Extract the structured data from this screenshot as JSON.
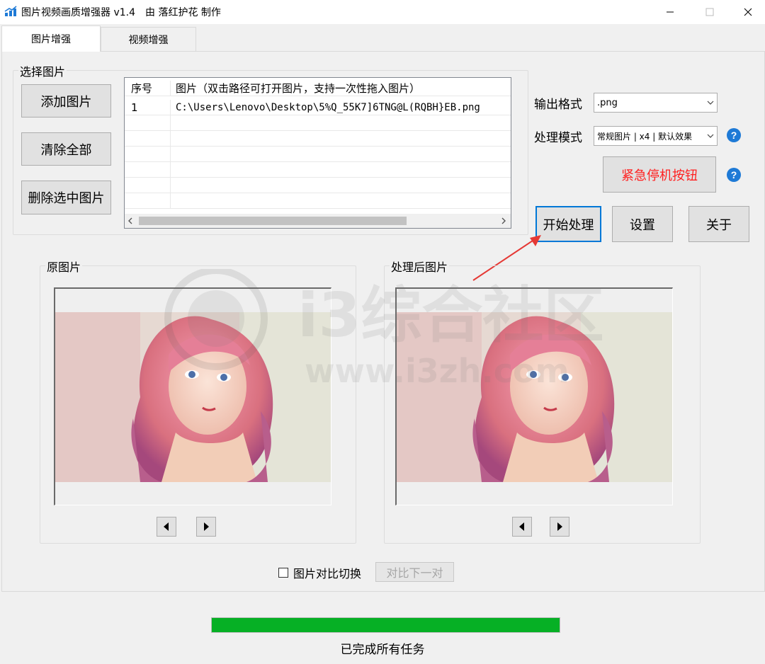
{
  "window": {
    "title": "图片视频画质增强器 v1.4　由 落红护花 制作"
  },
  "tabs": [
    {
      "label": "图片增强",
      "active": true
    },
    {
      "label": "视频增强",
      "active": false
    }
  ],
  "select_group": {
    "title": "选择图片",
    "buttons": {
      "add": "添加图片",
      "clear": "清除全部",
      "delete": "删除选中图片"
    },
    "list": {
      "headers": [
        "序号",
        "图片（双击路径可打开图片，支持一次性拖入图片）"
      ],
      "rows": [
        {
          "index": "1",
          "path": "C:\\Users\\Lenovo\\Desktop\\5%Q_55K7]6TNG@L(RQBH}EB.png"
        }
      ]
    }
  },
  "settings": {
    "output_format_label": "输出格式",
    "output_format_value": ".png",
    "mode_label": "处理模式",
    "mode_value": "常规图片 | x4 | 默认效果",
    "emergency_stop": "紧急停机按钮",
    "start": "开始处理",
    "settings": "设置",
    "about": "关于"
  },
  "preview": {
    "original_title": "原图片",
    "processed_title": "处理后图片",
    "compare_toggle_label": "图片对比切换",
    "compare_toggle_checked": false,
    "compare_next": "对比下一对"
  },
  "status": {
    "progress": 1.0,
    "text": "已完成所有任务"
  },
  "watermark": {
    "text": "i3综合社区",
    "url": "www.i3zh.com"
  },
  "colors": {
    "accent": "#0078d7",
    "progress": "#06b025",
    "stop_text": "#ff2020",
    "arrow": "#e53935"
  }
}
